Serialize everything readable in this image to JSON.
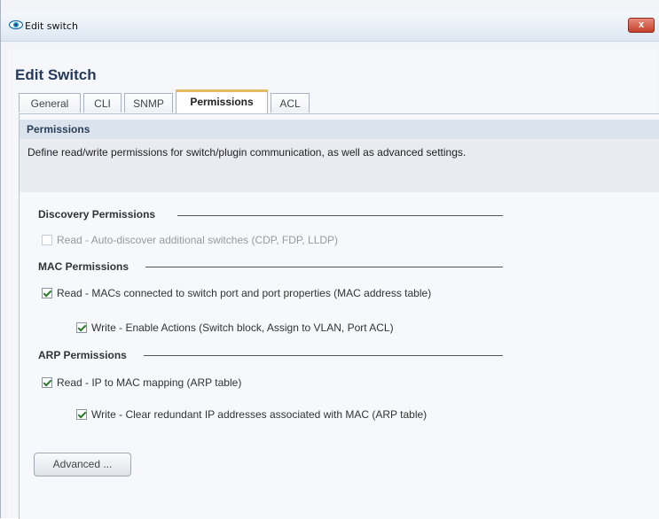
{
  "window": {
    "title": "Edit switch",
    "close_label": "x"
  },
  "heading": "Edit Switch",
  "tabs": [
    {
      "label": "General"
    },
    {
      "label": "CLI"
    },
    {
      "label": "SNMP"
    },
    {
      "label": "Permissions"
    },
    {
      "label": "ACL"
    }
  ],
  "active_tab": "Permissions",
  "panel": {
    "header": "Permissions",
    "description": "Define read/write permissions for switch/plugin communication, as well as advanced settings."
  },
  "sections": {
    "discovery": {
      "title": "Discovery Permissions",
      "read": {
        "label": "Read  - Auto-discover additional switches (CDP, FDP, LLDP)",
        "checked": false,
        "enabled": false
      }
    },
    "mac": {
      "title": "MAC Permissions",
      "read": {
        "label": "Read  - MACs connected to switch port and port properties (MAC address table)",
        "checked": true,
        "enabled": true
      },
      "write": {
        "label": "Write - Enable Actions (Switch block, Assign to VLAN, Port ACL)",
        "checked": true,
        "enabled": true
      }
    },
    "arp": {
      "title": "ARP Permissions",
      "read": {
        "label": "Read  - IP to MAC mapping (ARP table)",
        "checked": true,
        "enabled": true
      },
      "write": {
        "label": "Write - Clear redundant IP addresses associated with MAC (ARP table)",
        "checked": true,
        "enabled": true
      }
    }
  },
  "advanced_button": "Advanced ...",
  "colors": {
    "heading": "#253a5c",
    "active_tab_accent": "#e2bb62",
    "panel_header_bg": "#dbe3ec",
    "check_mark": "#2c7a2c",
    "close_button": "#c4402c"
  },
  "icons": {
    "app": "eye-icon",
    "close": "close-icon",
    "check": "checkmark-icon"
  }
}
